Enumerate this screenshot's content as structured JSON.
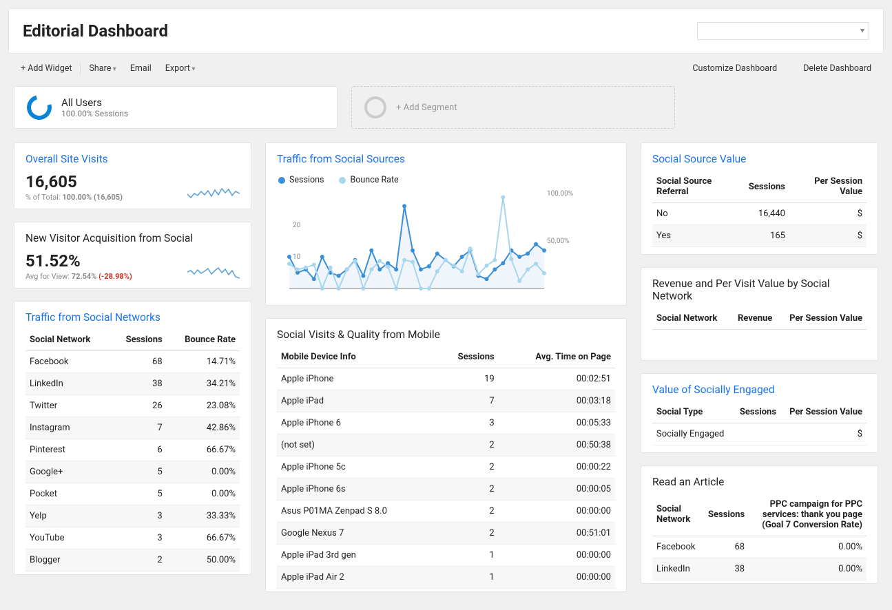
{
  "header": {
    "title": "Editorial Dashboard"
  },
  "toolbar": {
    "add_widget": "+ Add Widget",
    "share": "Share",
    "email": "Email",
    "export": "Export",
    "customize": "Customize Dashboard",
    "delete": "Delete Dashboard"
  },
  "segments": {
    "all_users_title": "All Users",
    "all_users_sub": "100.00% Sessions",
    "add_segment": "+ Add Segment"
  },
  "overall": {
    "title": "Overall Site Visits",
    "value": "16,605",
    "sub_prefix": "% of Total: ",
    "sub_bold": "100.00% (16,605)"
  },
  "new_visitor": {
    "title": "New Visitor Acquisition from Social",
    "value": "51.52%",
    "sub_prefix": "Avg for View: ",
    "sub_bold": "72.54%",
    "delta": " (-28.98%)"
  },
  "traffic_networks": {
    "title": "Traffic from Social Networks",
    "cols": [
      "Social Network",
      "Sessions",
      "Bounce Rate"
    ],
    "rows": [
      [
        "Facebook",
        "68",
        "14.71%"
      ],
      [
        "LinkedIn",
        "38",
        "34.21%"
      ],
      [
        "Twitter",
        "26",
        "23.08%"
      ],
      [
        "Instagram",
        "7",
        "42.86%"
      ],
      [
        "Pinterest",
        "6",
        "66.67%"
      ],
      [
        "Google+",
        "5",
        "0.00%"
      ],
      [
        "Pocket",
        "5",
        "0.00%"
      ],
      [
        "Yelp",
        "3",
        "33.33%"
      ],
      [
        "YouTube",
        "3",
        "66.67%"
      ],
      [
        "Blogger",
        "2",
        "50.00%"
      ]
    ]
  },
  "traffic_sources": {
    "title": "Traffic from Social Sources",
    "legend_a": "Sessions",
    "legend_b": "Bounce Rate",
    "y_label": "20",
    "y_label2": "10",
    "right_labels": [
      "100.00%",
      "50.00%"
    ]
  },
  "chart_data": {
    "type": "line",
    "title": "Traffic from Social Sources",
    "series": [
      {
        "name": "Sessions",
        "color": "#3b8fd6",
        "values": [
          10,
          5,
          6,
          3,
          10,
          5,
          4,
          6,
          9,
          4,
          12,
          6,
          8,
          6,
          26,
          12,
          6,
          7,
          11,
          9,
          7,
          10,
          12,
          4,
          3,
          6,
          8,
          12,
          10,
          11,
          14,
          12
        ]
      },
      {
        "name": "Bounce Rate",
        "color": "#a8d6ef",
        "values": [
          26,
          20,
          22,
          25,
          0,
          22,
          0,
          20,
          29,
          0,
          20,
          29,
          23,
          0,
          30,
          28,
          0,
          0,
          18,
          30,
          24,
          18,
          42,
          15,
          24,
          30,
          96,
          31,
          8,
          20,
          26,
          16
        ]
      }
    ],
    "y_left": {
      "label": "Sessions",
      "min": 0,
      "max": 30,
      "ticks": [
        10,
        20
      ]
    },
    "y_right": {
      "label": "Bounce Rate",
      "min": 0,
      "max": 100,
      "ticks": [
        50,
        100
      ]
    },
    "x_count": 32
  },
  "mobile": {
    "title": "Social Visits & Quality from Mobile",
    "cols": [
      "Mobile Device Info",
      "Sessions",
      "Avg. Time on Page"
    ],
    "rows": [
      [
        "Apple iPhone",
        "19",
        "00:02:51"
      ],
      [
        "Apple iPad",
        "7",
        "00:03:18"
      ],
      [
        "Apple iPhone 6",
        "3",
        "00:05:33"
      ],
      [
        "(not set)",
        "2",
        "00:50:38"
      ],
      [
        "Apple iPhone 5c",
        "2",
        "00:00:22"
      ],
      [
        "Apple iPhone 6s",
        "2",
        "00:00:05"
      ],
      [
        "Asus P01MA Zenpad S 8.0",
        "2",
        "00:00:00"
      ],
      [
        "Google Nexus 7",
        "2",
        "00:51:01"
      ],
      [
        "Apple iPad 3rd gen",
        "1",
        "00:00:00"
      ],
      [
        "Apple iPad Air 2",
        "1",
        "00:00:00"
      ]
    ]
  },
  "source_value": {
    "title": "Social Source Value",
    "cols": [
      "Social Source Referral",
      "Sessions",
      "Per Session Value"
    ],
    "rows": [
      [
        "No",
        "16,440",
        "$"
      ],
      [
        "Yes",
        "165",
        "$"
      ]
    ]
  },
  "revenue": {
    "title": "Revenue and Per Visit Value by Social Network",
    "cols": [
      "Social Network",
      "Revenue",
      "Per Session Value"
    ]
  },
  "engaged": {
    "title": "Value of Socially Engaged",
    "cols": [
      "Social Type",
      "Sessions",
      "Per Session Value"
    ],
    "rows": [
      [
        "Socially Engaged",
        "",
        "$"
      ]
    ]
  },
  "read_article": {
    "title": "Read an Article",
    "cols": [
      "Social Network",
      "Sessions",
      "PPC campaign for PPC services: thank you page (Goal 7 Conversion Rate)"
    ],
    "rows": [
      [
        "Facebook",
        "68",
        "0.00%"
      ],
      [
        "LinkedIn",
        "38",
        "0.00%"
      ]
    ]
  }
}
